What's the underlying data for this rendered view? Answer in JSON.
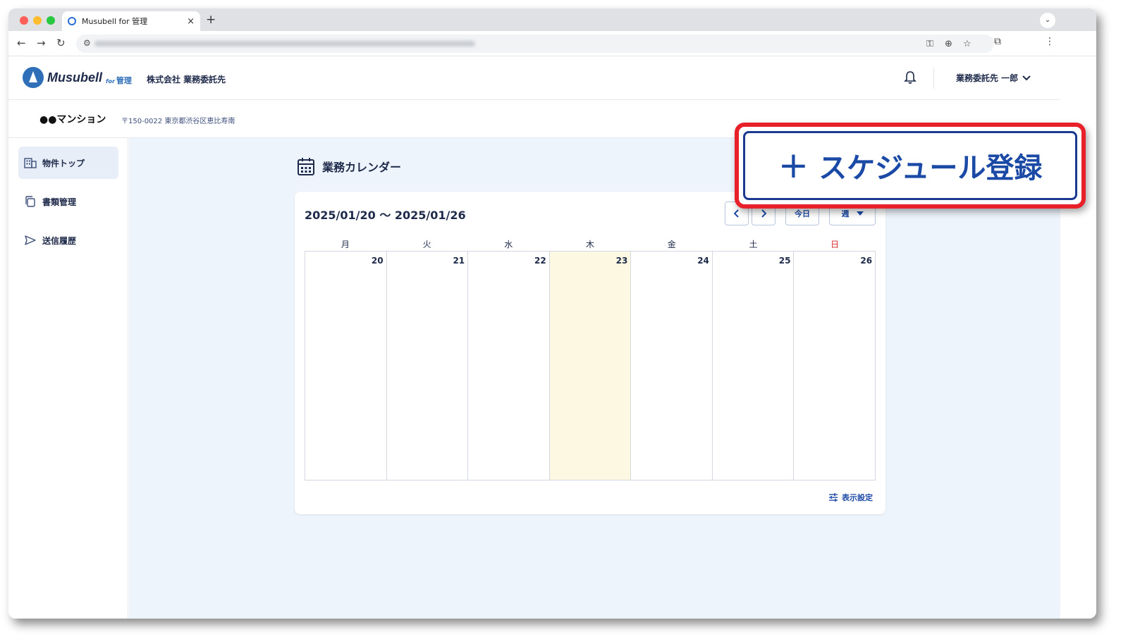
{
  "browser": {
    "tab_title": "Musubell for 管理",
    "tab_close": "×",
    "new_tab": "+",
    "tab_menu": "⌄"
  },
  "header": {
    "logo_text": "Musubell",
    "logo_for": "for",
    "logo_sub": "管理",
    "company": "株式会社 業務委託先",
    "user": "業務委託先 一郎"
  },
  "property": {
    "name": "●●マンション",
    "address": "〒150-0022 東京都渋谷区恵比寿南"
  },
  "sidebar": {
    "items": [
      {
        "label": "物件トップ",
        "icon": "building-icon",
        "active": true
      },
      {
        "label": "書類管理",
        "icon": "documents-icon",
        "active": false
      },
      {
        "label": "送信履歴",
        "icon": "send-icon",
        "active": false
      }
    ]
  },
  "calendar": {
    "title": "業務カレンダー",
    "range": "2025/01/20 〜 2025/01/26",
    "today_label": "今日",
    "view_label": "週",
    "weekdays": [
      "月",
      "火",
      "水",
      "木",
      "金",
      "土",
      "日"
    ],
    "dates": [
      "20",
      "21",
      "22",
      "23",
      "24",
      "25",
      "26"
    ],
    "today_index": 3,
    "display_settings": "表示設定"
  },
  "callout": {
    "plus": "+",
    "label": "スケジュール登録"
  },
  "colors": {
    "accent": "#1e4aa8",
    "highlight_border": "#e8202a",
    "today_bg": "#fdf8e1",
    "main_bg": "#eef4fc"
  }
}
